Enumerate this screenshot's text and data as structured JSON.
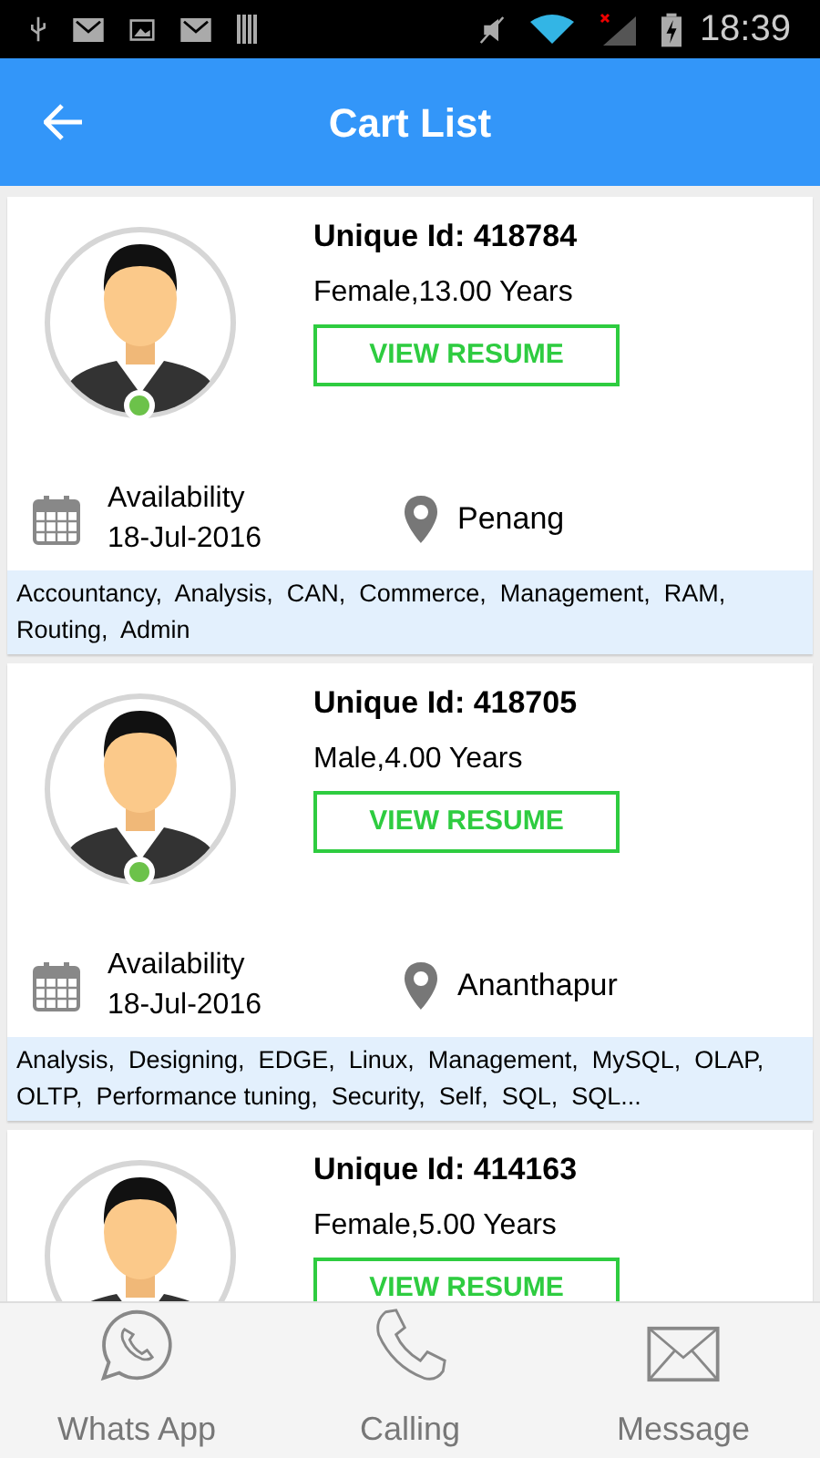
{
  "status_bar": {
    "time": "18:39"
  },
  "header": {
    "title": "Cart List"
  },
  "candidates": [
    {
      "unique_id": "Unique Id: 418784",
      "info": "Female,13.00 Years",
      "button": "VIEW RESUME",
      "online": true,
      "availability_label": "Availability",
      "availability_date": "18-Jul-2016",
      "location": "Penang",
      "skills": "Accountancy,  Analysis,  CAN,  Commerce,  Management,  RAM,  Routing,  Admin"
    },
    {
      "unique_id": "Unique Id: 418705",
      "info": "Male,4.00 Years",
      "button": "VIEW RESUME",
      "online": true,
      "availability_label": "Availability",
      "availability_date": "18-Jul-2016",
      "location": "Ananthapur",
      "skills": "Analysis,  Designing,  EDGE,  Linux,  Management,  MySQL,  OLAP,  OLTP,  Performance tuning,  Security,  Self,  SQL,  SQL..."
    },
    {
      "unique_id": "Unique Id: 414163",
      "info": "Female,5.00 Years",
      "button": "VIEW RESUME"
    }
  ],
  "bottom_bar": [
    {
      "kind": "whatsapp",
      "label": "Whats App"
    },
    {
      "kind": "phone",
      "label": "Calling"
    },
    {
      "kind": "mail",
      "label": "Message"
    }
  ]
}
